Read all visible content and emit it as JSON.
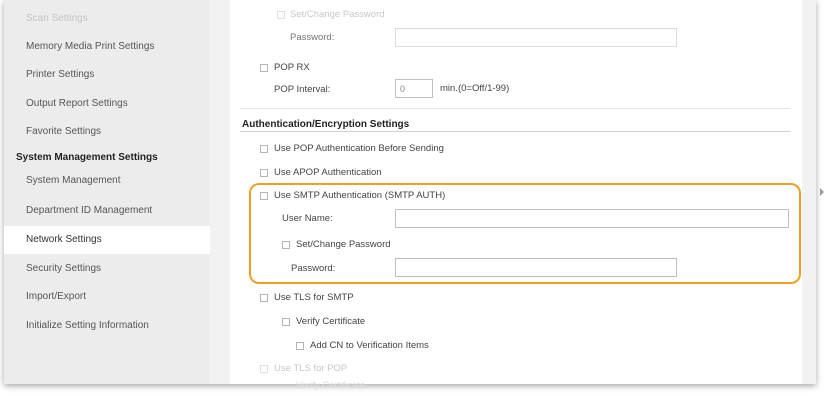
{
  "sidebar": {
    "items": [
      {
        "label": "Scan Settings"
      },
      {
        "label": "Memory Media Print Settings"
      },
      {
        "label": "Printer Settings"
      },
      {
        "label": "Output Report Settings"
      },
      {
        "label": "Favorite Settings"
      },
      {
        "label": "System Management Settings"
      },
      {
        "label": "System Management"
      },
      {
        "label": "Department ID Management"
      },
      {
        "label": "Network Settings"
      },
      {
        "label": "Security Settings"
      },
      {
        "label": "Import/Export"
      },
      {
        "label": "Initialize Setting Information"
      }
    ]
  },
  "main": {
    "top_set_change_password": "Set/Change Password",
    "top_password_label": "Password:",
    "pop_rx": "POP RX",
    "pop_interval_label": "POP Interval:",
    "pop_interval_value": "0",
    "pop_interval_unit": "min.(0=Off/1-99)",
    "section_title": "Authentication/Encryption Settings",
    "use_pop_auth": "Use POP Authentication Before Sending",
    "use_apop": "Use APOP Authentication",
    "use_smtp_auth": "Use SMTP Authentication (SMTP AUTH)",
    "user_name_label": "User Name:",
    "smtp_set_change_password": "Set/Change Password",
    "smtp_password_label": "Password:",
    "use_tls_smtp": "Use TLS for SMTP",
    "verify_certificate": "Verify Certificate",
    "add_cn": "Add CN to Verification Items",
    "use_tls_pop": "Use TLS for POP",
    "verify_certificate_pop": "Verify Certificate"
  },
  "colors": {
    "highlight": "#f0a021",
    "active_item_bg": "#ffffff",
    "sidebar_bg": "#ececec"
  }
}
